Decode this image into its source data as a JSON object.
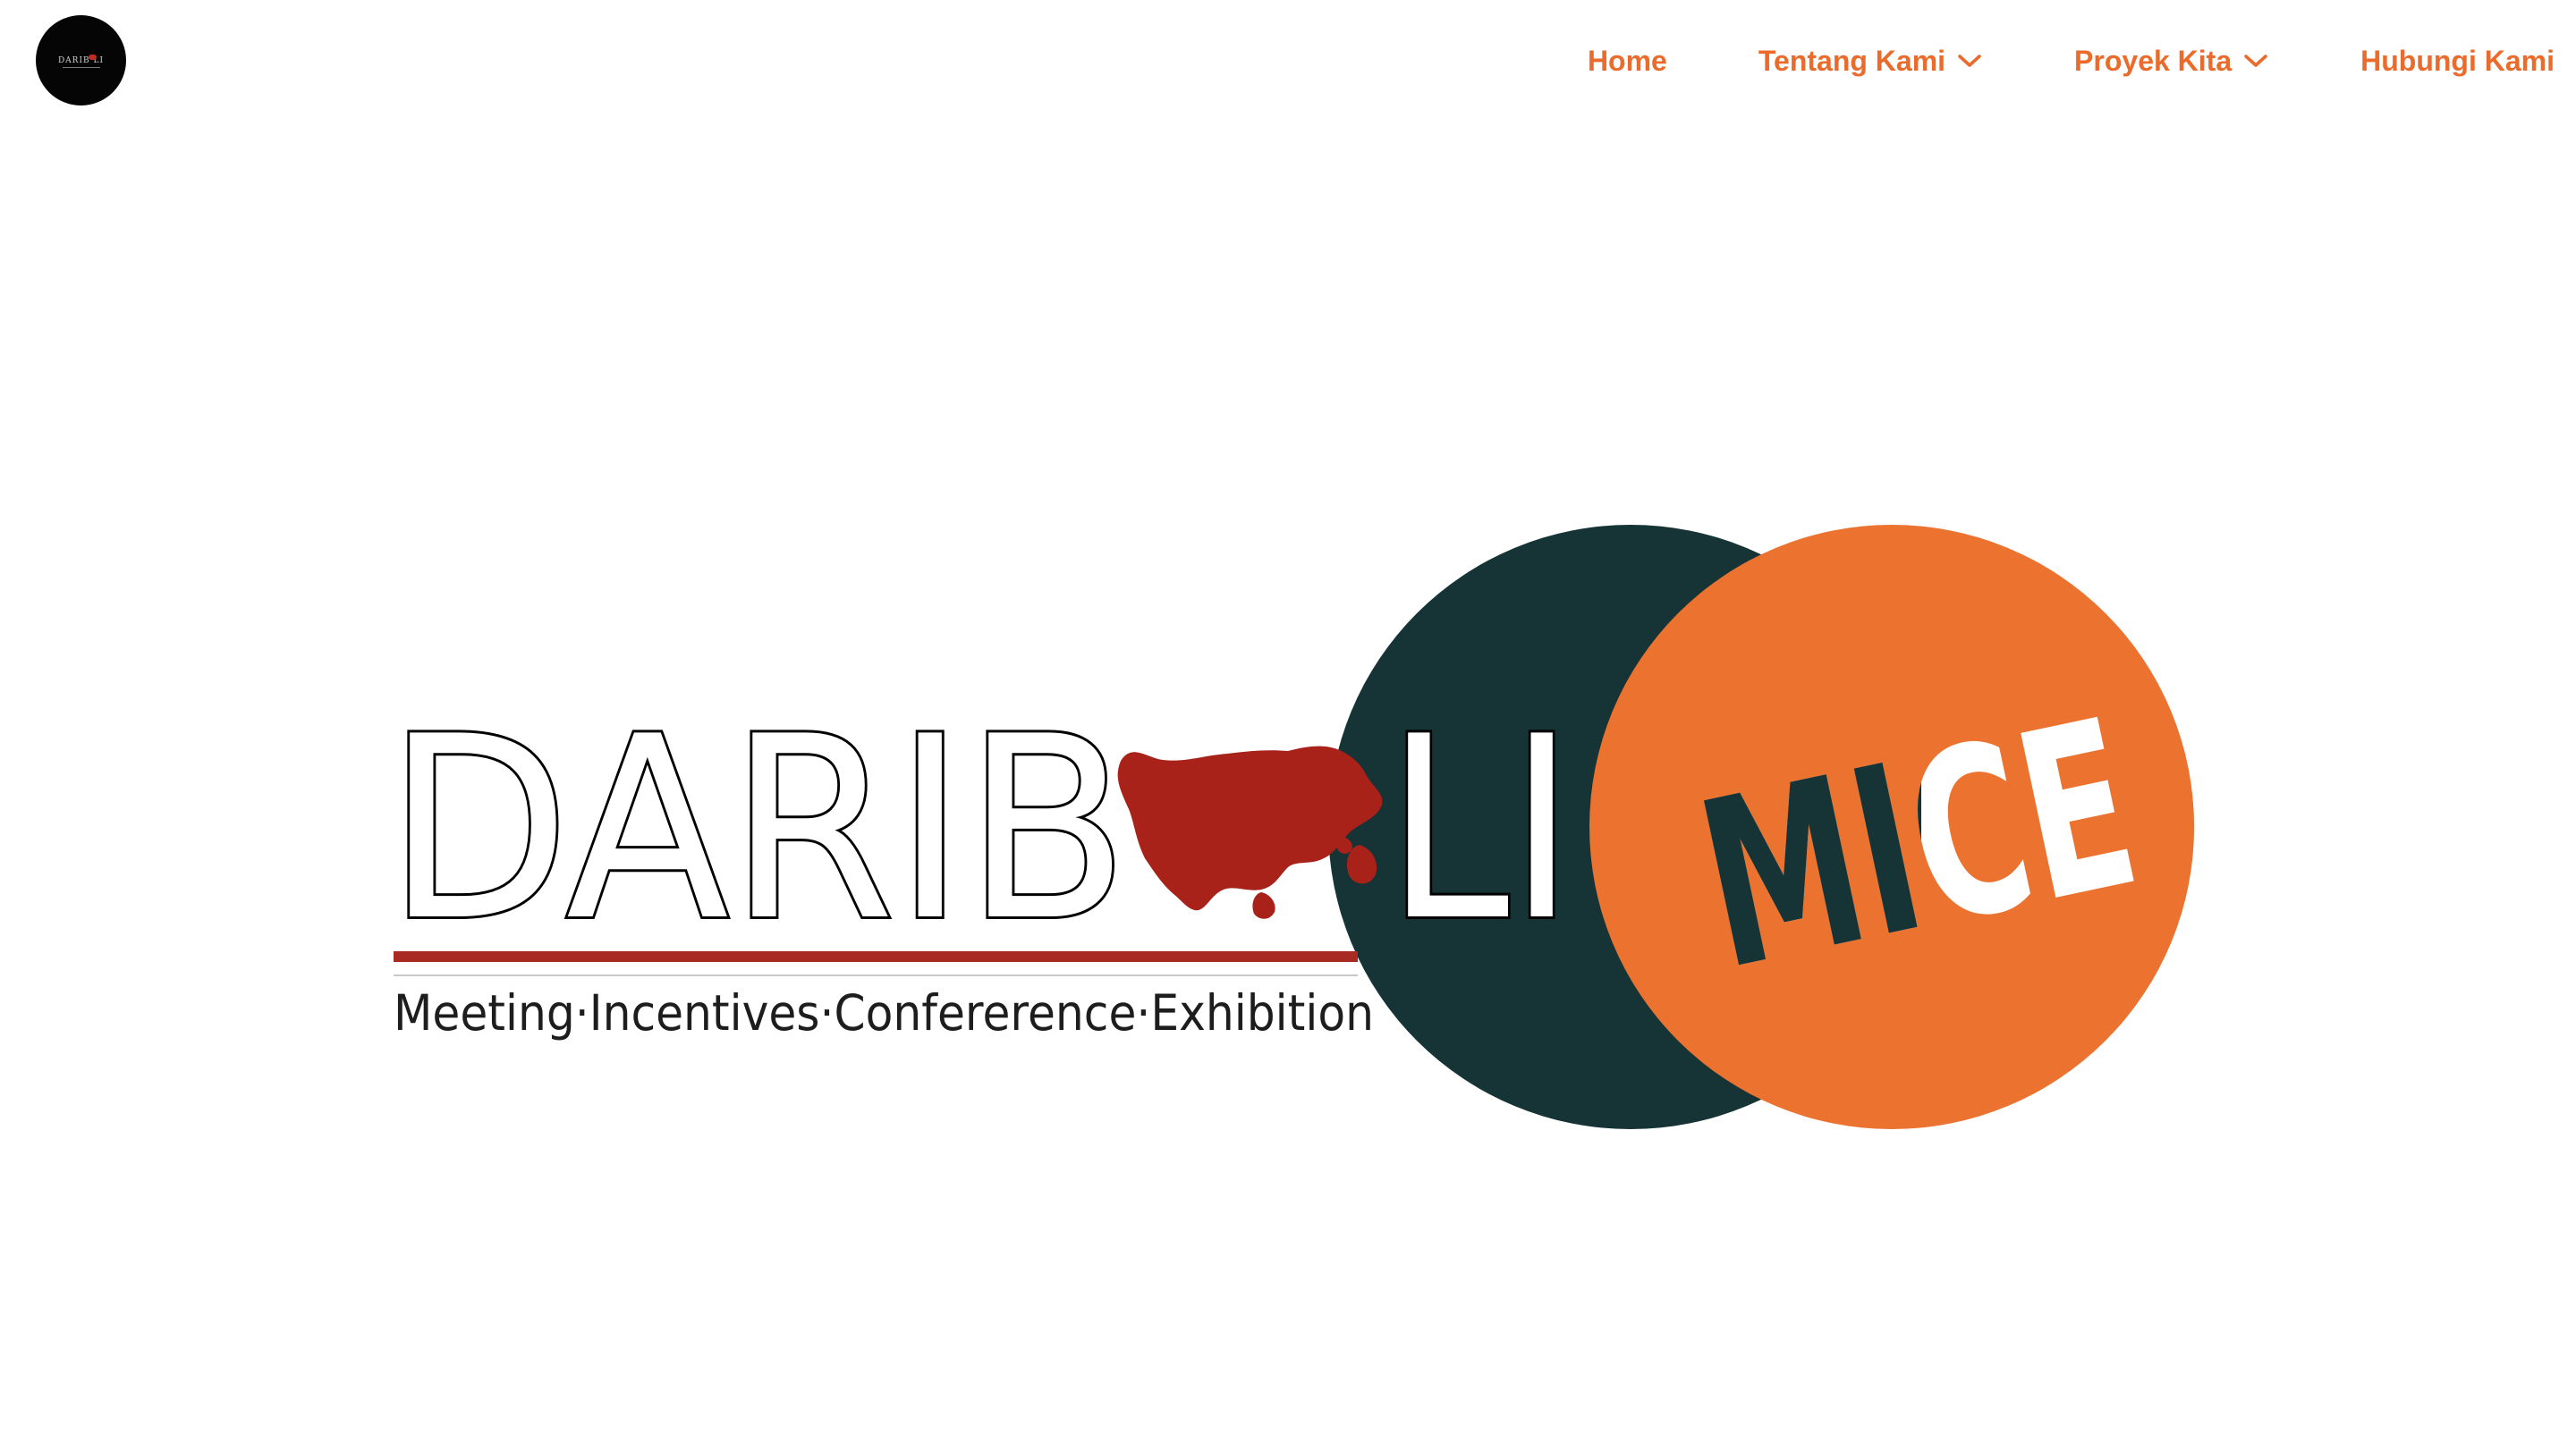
{
  "header": {
    "logo_alt": "Daribali logo",
    "logo_mini_text": "DARIB LI",
    "nav": [
      {
        "label": "Home",
        "has_dropdown": false
      },
      {
        "label": "Tentang Kami",
        "has_dropdown": true,
        "icon": "chevron-down-icon"
      },
      {
        "label": "Proyek Kita",
        "has_dropdown": true,
        "icon": "chevron-down-icon"
      },
      {
        "label": "Hubungi Kami",
        "has_dropdown": false
      }
    ]
  },
  "hero": {
    "brand_left": "DARIB",
    "brand_right": "LI",
    "brand_icon": "bali-island-icon",
    "tagline": "Meeting·Incentives·Confererence·Exhibition",
    "badge": "MICE"
  },
  "colors": {
    "accent": "#ea6b2b",
    "dark_circle": "#163336",
    "orange_circle": "#ec722f",
    "bali_red": "#a8221a",
    "rule_red": "#a82a22",
    "logo_bg": "#050505"
  }
}
